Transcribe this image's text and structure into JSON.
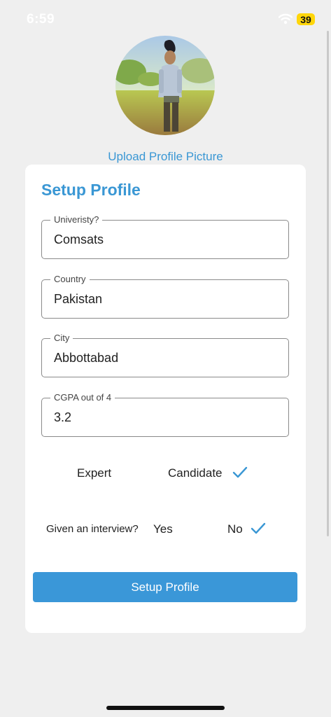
{
  "status": {
    "time": "6:59",
    "battery": "39"
  },
  "profile": {
    "upload_label": "Upload Profile Picture"
  },
  "form": {
    "title": "Setup Profile",
    "fields": [
      {
        "label": "Univeristy?",
        "value": "Comsats"
      },
      {
        "label": "Country",
        "value": "Pakistan"
      },
      {
        "label": "City",
        "value": "Abbottabad"
      },
      {
        "label": "CGPA out of 4",
        "value": "3.2"
      }
    ],
    "role": {
      "options": [
        "Expert",
        "Candidate"
      ],
      "selected": "Candidate"
    },
    "interview": {
      "prompt": "Given an interview?",
      "options": [
        "Yes",
        "No"
      ],
      "selected": "No"
    },
    "submit_label": "Setup Profile"
  },
  "colors": {
    "accent": "#3a97d4",
    "button": "#3a97d8",
    "background": "#efefef",
    "card": "#ffffff"
  },
  "icons": {
    "status_wifi": "wifi-icon",
    "checkmark": "check-icon"
  }
}
